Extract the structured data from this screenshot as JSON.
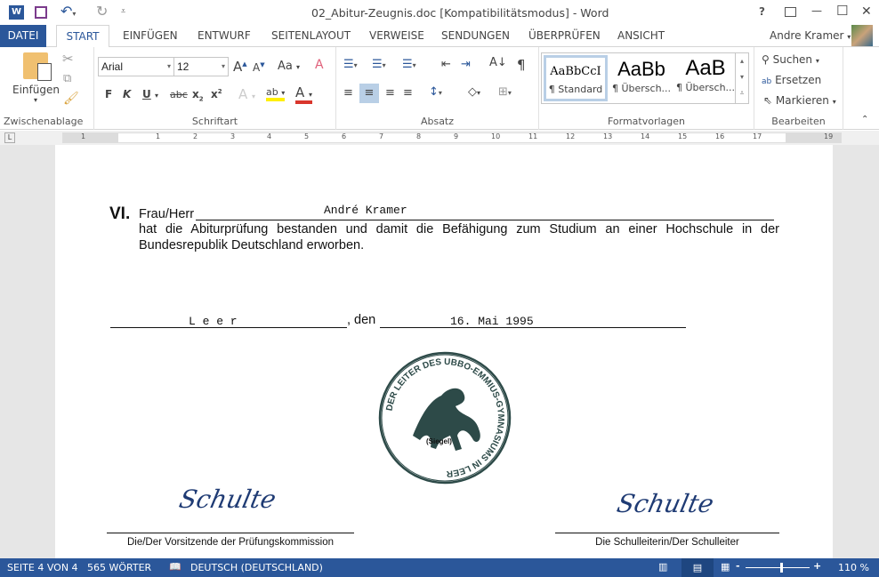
{
  "title": "02_Abitur-Zeugnis.doc [Kompatibilitätsmodus] - Word",
  "window_controls": {
    "help": "?",
    "minimize": "—",
    "maximize": "☐",
    "close": "✕"
  },
  "tabs": [
    "DATEI",
    "START",
    "EINFÜGEN",
    "ENTWURF",
    "SEITENLAYOUT",
    "VERWEISE",
    "SENDUNGEN",
    "ÜBERPRÜFEN",
    "ANSICHT"
  ],
  "user": "Andre Kramer",
  "ribbon": {
    "clipboard": {
      "paste": "Einfügen",
      "label": "Zwischenablage"
    },
    "font": {
      "name": "Arial",
      "size": "12",
      "bold": "F",
      "italic": "K",
      "underline": "U",
      "strike": "abc",
      "label": "Schriftart",
      "case": "Aa"
    },
    "paragraph": {
      "label": "Absatz"
    },
    "styles": {
      "items": [
        {
          "preview": "AaBbCcI",
          "name": "¶ Standard"
        },
        {
          "preview": "AaBb",
          "name": "¶ Übersch..."
        },
        {
          "preview": "AaB",
          "name": "¶ Übersch..."
        }
      ],
      "label": "Formatvorlagen"
    },
    "editing": {
      "find": "Suchen",
      "replace": "Ersetzen",
      "select": "Markieren",
      "label": "Bearbeiten"
    }
  },
  "ruler": [
    "1",
    "1",
    "2",
    "3",
    "4",
    "5",
    "6",
    "7",
    "8",
    "9",
    "10",
    "11",
    "12",
    "13",
    "14",
    "15",
    "16",
    "17",
    "19"
  ],
  "document": {
    "section": "VI.",
    "salutation": "Frau/Herr",
    "name": "André Kramer",
    "line1": "hat die Abiturprüfung bestanden und damit die Befähigung zum Studium an einer Hochschule in der",
    "line2": "Bundesrepublik Deutschland erworben.",
    "place": "L e e r",
    "den": ", den",
    "date": "16. Mai 1995",
    "seal_text": "DER LEITER DES UBBO-EMMIUS-GYMNASIUMS IN LEER",
    "seal_label": "(Siegel)",
    "signature": "Schulte",
    "sig_left_caption": "Die/Der Vorsitzende der Prüfungskommission",
    "sig_right_caption": "Die Schulleiterin/Der Schulleiter"
  },
  "status": {
    "page": "SEITE 4 VON 4",
    "words": "565 WÖRTER",
    "language": "DEUTSCH (DEUTSCHLAND)",
    "zoom": "110 %",
    "zoom_fraction": 0.55
  },
  "colors": {
    "accent": "#2b579a"
  }
}
